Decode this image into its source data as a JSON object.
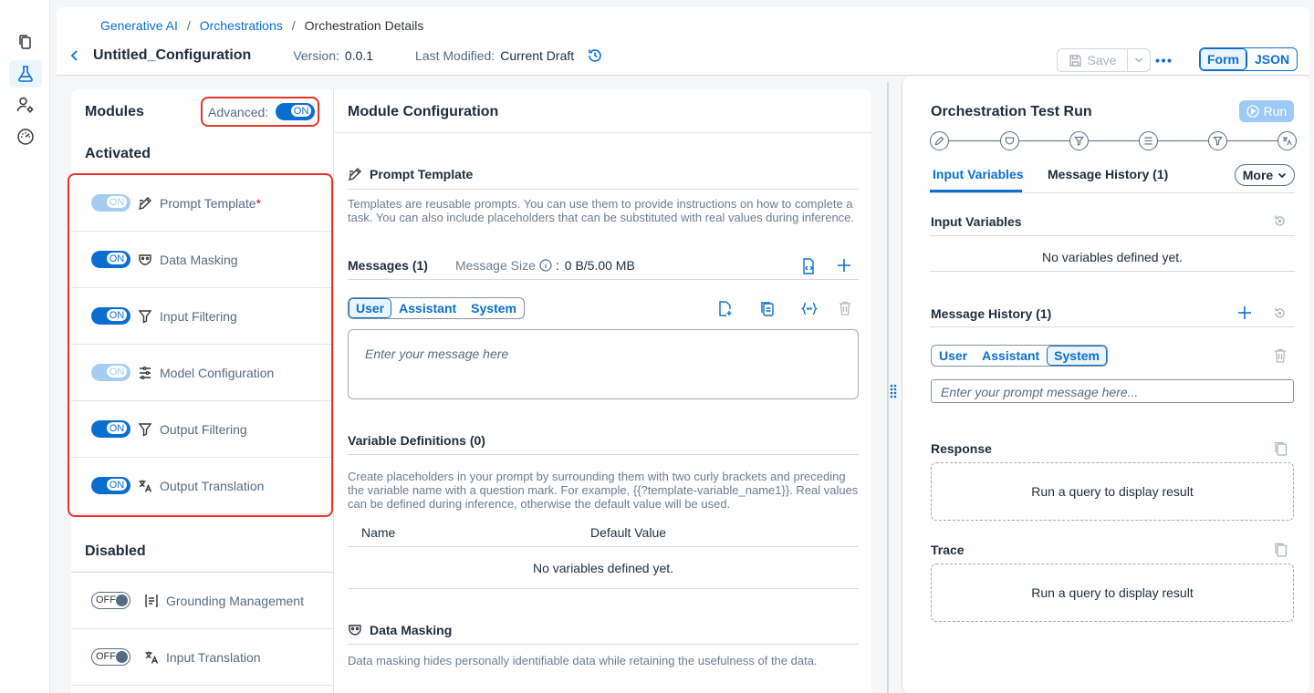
{
  "breadcrumb": {
    "item1": "Generative AI",
    "item2": "Orchestrations",
    "item3": "Orchestration Details",
    "separator": "/"
  },
  "header": {
    "title": "Untitled_Configuration",
    "version_label": "Version:",
    "version_value": "0.0.1",
    "last_modified_label": "Last Modified:",
    "last_modified_value": "Current Draft",
    "save_label": "Save",
    "view_form": "Form",
    "view_json": "JSON"
  },
  "modules": {
    "title": "Modules",
    "advanced_label": "Advanced:",
    "advanced_state": "ON",
    "activated_title": "Activated",
    "disabled_title": "Disabled",
    "activated": [
      {
        "name": "Prompt Template",
        "state": "ON",
        "required": "*"
      },
      {
        "name": "Data Masking",
        "state": "ON"
      },
      {
        "name": "Input Filtering",
        "state": "ON"
      },
      {
        "name": "Model Configuration",
        "state": "ON"
      },
      {
        "name": "Output Filtering",
        "state": "ON"
      },
      {
        "name": "Output Translation",
        "state": "ON"
      }
    ],
    "disabled": [
      {
        "name": "Grounding Management",
        "state": "OFF"
      },
      {
        "name": "Input Translation",
        "state": "OFF"
      }
    ]
  },
  "config": {
    "title": "Module Configuration",
    "prompt_template": {
      "title": "Prompt Template",
      "description": "Templates are reusable prompts. You can use them to provide instructions on how to complete a task. You can also include placeholders that can be substituted with real values during inference."
    },
    "messages": {
      "title": "Messages (1)",
      "size_label": "Message Size",
      "size_colon": ":",
      "size_value": "0 B/5.00 MB",
      "roles": [
        "User",
        "Assistant",
        "System"
      ],
      "placeholder": "Enter your message here"
    },
    "variables": {
      "title": "Variable Definitions (0)",
      "description": "Create placeholders in your prompt by surrounding them with two curly brackets and preceding the variable name with a question mark. For example, {{?template-variable_name1}}. Real values can be defined during inference, otherwise the default value will be used.",
      "col_name": "Name",
      "col_default": "Default Value",
      "empty": "No variables defined yet."
    },
    "data_masking": {
      "title": "Data Masking",
      "description": "Data masking hides personally identifiable data while retaining the usefulness of the data."
    }
  },
  "testrun": {
    "title": "Orchestration Test Run",
    "run_label": "Run",
    "tabs": {
      "input_variables": "Input Variables",
      "message_history": "Message History (1)",
      "more": "More"
    },
    "input_variables": {
      "title": "Input Variables",
      "empty": "No variables defined yet."
    },
    "message_history": {
      "title": "Message History (1)",
      "roles": [
        "User",
        "Assistant",
        "System"
      ],
      "placeholder": "Enter your prompt message here..."
    },
    "response": {
      "title": "Response",
      "empty": "Run a query to display result"
    },
    "trace": {
      "title": "Trace",
      "empty": "Run a query to display result"
    }
  },
  "colors": {
    "accent": "#0a6ed1",
    "highlight": "#e5352b"
  }
}
